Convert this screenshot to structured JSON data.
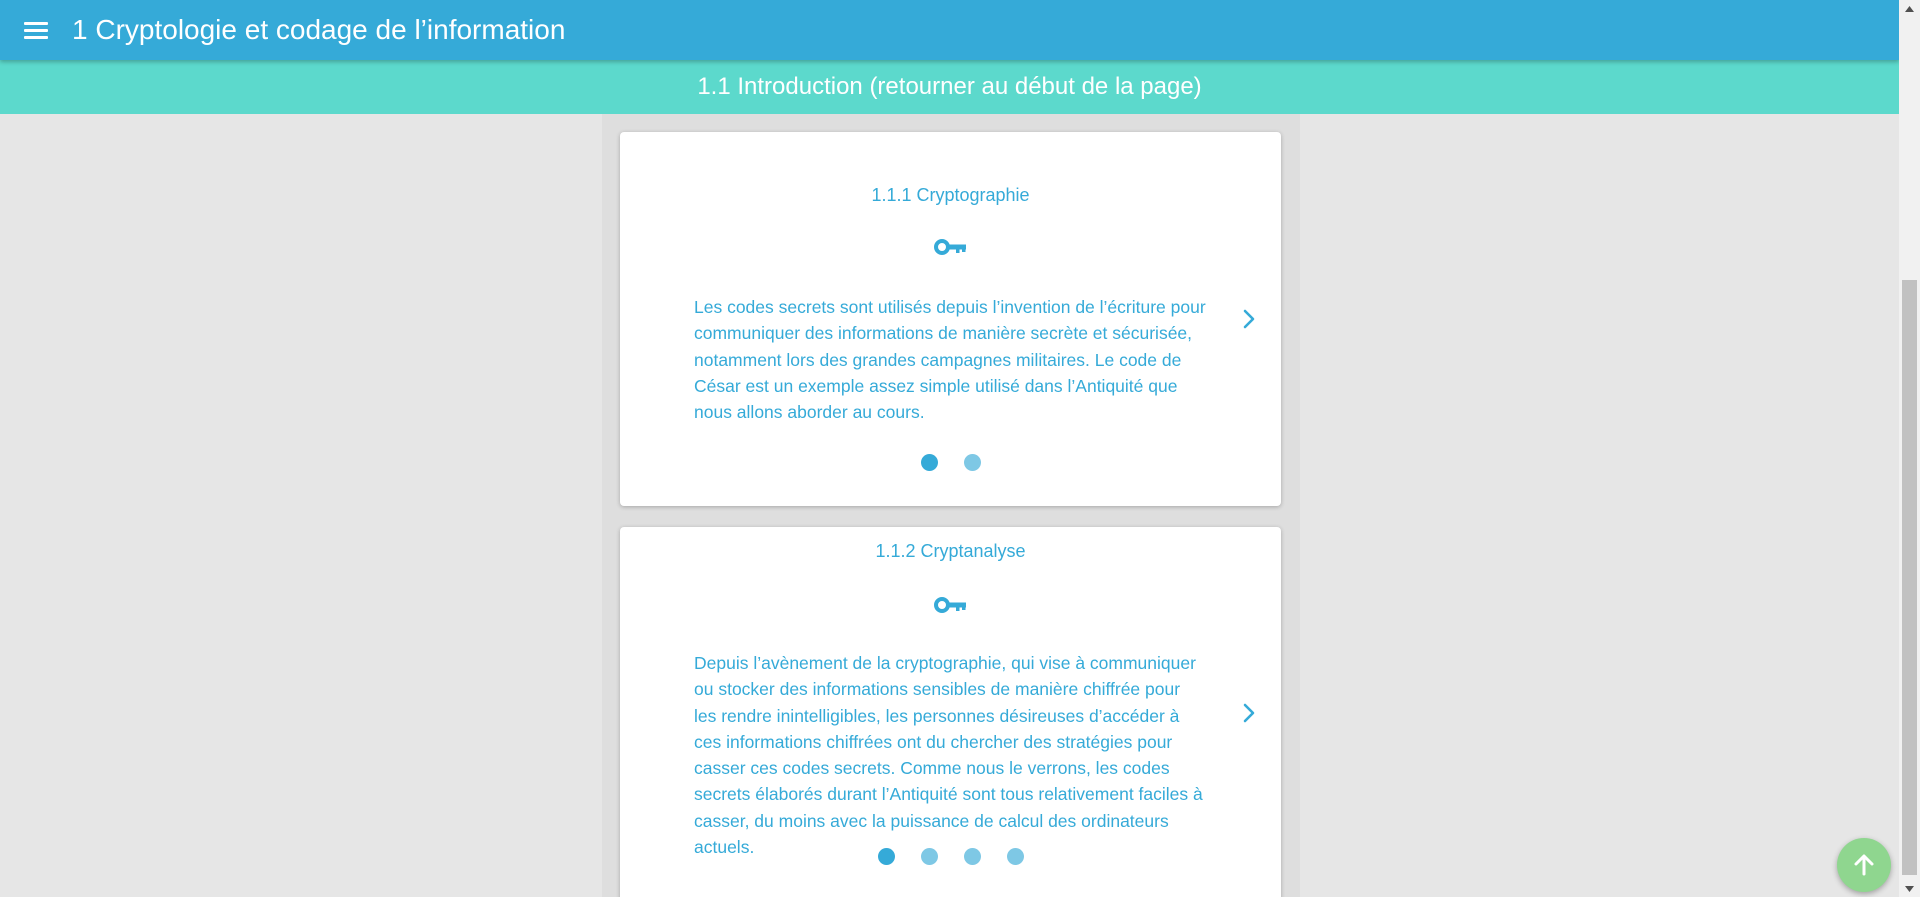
{
  "header": {
    "title": "1 Cryptologie et codage de l’information",
    "menu_icon": "hamburger-menu-icon"
  },
  "section_bar": {
    "link_text": "1.1 Introduction (retourner au début de la page)"
  },
  "cards": [
    {
      "title": "1.1.1 Cryptographie",
      "icon": "key-icon",
      "text": "Les codes secrets sont utilisés depuis l’invention de l’écriture pour communiquer des informations de manière secrète et sécurisée, notamment lors des grandes campagnes militaires. Le code de César est un exemple assez simple utilisé dans l’Antiquité que nous allons aborder au cours.",
      "slides": 2,
      "active_slide": 1
    },
    {
      "title": "1.1.2 Cryptanalyse",
      "icon": "key-icon",
      "text": "Depuis l’avènement de la cryptographie, qui vise à communiquer ou stocker des informations sensibles de manière chiffrée pour les rendre inintelligibles, les personnes désireuses d’accéder à ces informations chiffrées ont du chercher des stratégies pour casser ces codes secrets. Comme nous le verrons, les codes secrets élaborés durant l’Antiquité sont tous relativement faciles à casser, du moins avec la puissance de calcul des ordinateurs actuels.",
      "slides": 4,
      "active_slide": 1
    }
  ],
  "fab": {
    "icon": "arrow-up-icon"
  },
  "colors": {
    "primary": "#35aad8",
    "secondary": "#5cd9cc",
    "fab": "#8fd68f",
    "background": "#e6e6e6"
  }
}
